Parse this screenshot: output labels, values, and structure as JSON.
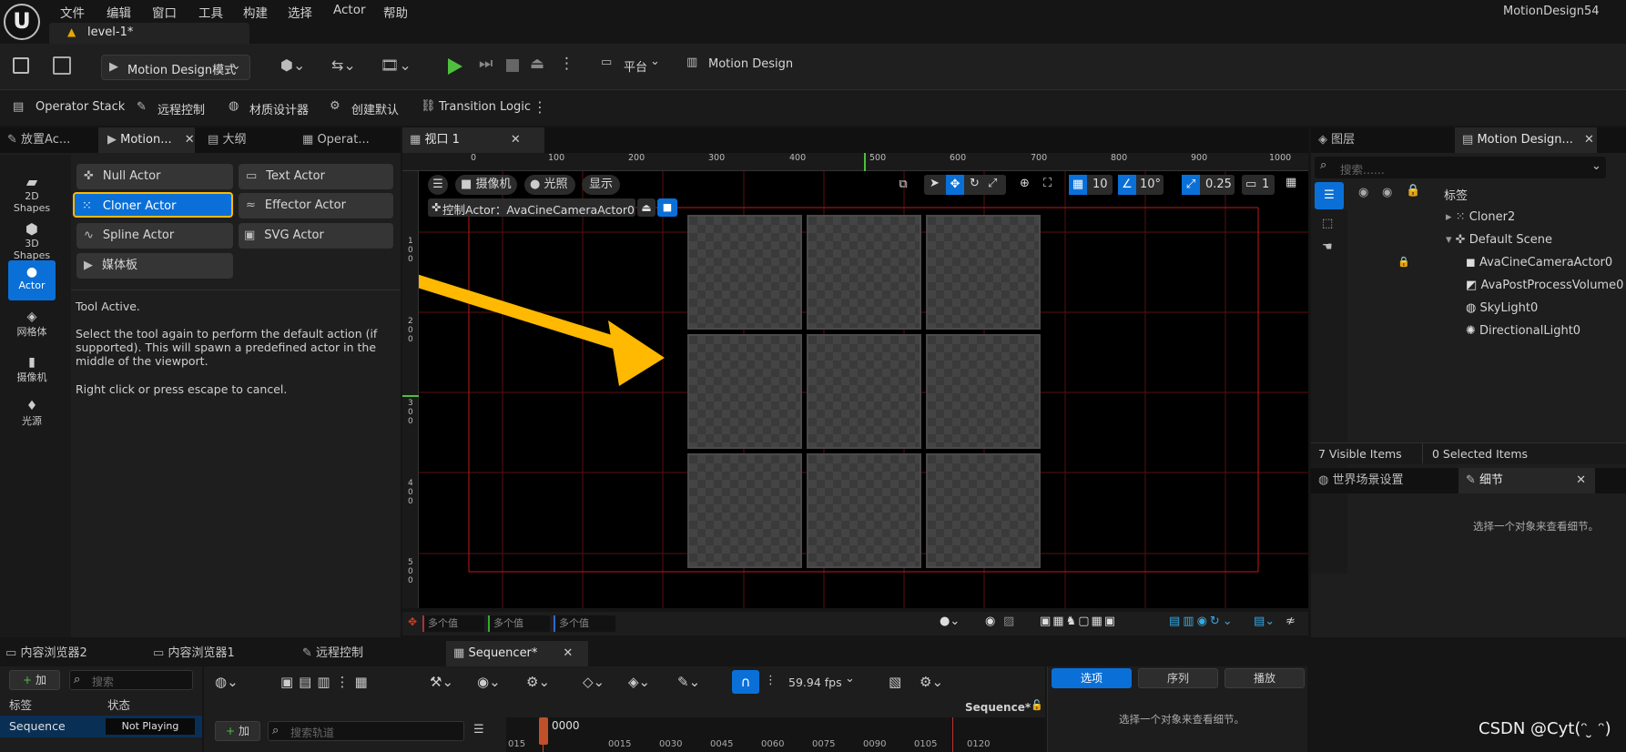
{
  "menu": {
    "items": [
      "文件",
      "编辑",
      "窗口",
      "工具",
      "构建",
      "选择",
      "Actor",
      "帮助"
    ],
    "project_name": "MotionDesign54",
    "level_tab": "level-1*"
  },
  "toolbar": {
    "mode_label": "Motion Design模式",
    "platform_label": "平台",
    "motion_design_label": "Motion Design"
  },
  "toolbar2": {
    "operator_stack": "Operator Stack",
    "remote_control": "远程控制",
    "material_designer": "材质设计器",
    "create_defaults": "创建默认",
    "transition_logic": "Transition Logic"
  },
  "left_panel": {
    "tabs": [
      "放置Ac...",
      "Motion...",
      "大纲",
      "Operat..."
    ],
    "rail": [
      "2D Shapes",
      "3D Shapes",
      "Actor",
      "网格体",
      "摄像机",
      "光源"
    ],
    "actors": [
      "Null Actor",
      "Text Actor",
      "Cloner Actor",
      "Effector Actor",
      "Spline Actor",
      "SVG Actor",
      "媒体板"
    ],
    "info_title": "Tool Active.",
    "info_body": "Select the tool again to perform the default action (if supported). This will spawn a predefined actor in the middle of the viewport.",
    "info_cancel": "Right click or press escape to cancel."
  },
  "viewport": {
    "tab_label": "视口 1",
    "ruler_top": [
      "0",
      "100",
      "200",
      "300",
      "400",
      "500",
      "600",
      "700",
      "800",
      "900",
      "1000"
    ],
    "ruler_left": [
      "1\n0\n0",
      "2\n0\n0",
      "3\n0\n0",
      "4\n0\n0",
      "5\n0\n0"
    ],
    "camera_btn": "摄像机",
    "lighting_btn": "光照",
    "show_btn": "显示",
    "pilot_label": "控制Actor：AvaCineCameraActor0",
    "grid_value": "10",
    "angle_value": "10°",
    "scale_value": "0.25",
    "cam_speed": "1",
    "bottom_fields": [
      "多个值",
      "多个值",
      "多个值"
    ]
  },
  "right_panel": {
    "tabs": [
      "图层",
      "Motion Design..."
    ],
    "search_placeholder": "搜索......",
    "column_label": "标签",
    "tree": [
      "Cloner2",
      "Default Scene",
      "AvaCineCameraActor0",
      "AvaPostProcessVolume0",
      "SkyLight0",
      "DirectionalLight0"
    ],
    "visible_items": "7  Visible Items",
    "selected_items": "0  Selected Items",
    "details_tabs": [
      "世界场景设置",
      "细节"
    ],
    "details_hint": "选择一个对象来查看细节。"
  },
  "bottom": {
    "tabs": [
      "内容浏览器2",
      "内容浏览器1",
      "远程控制",
      "Sequencer*"
    ],
    "add_label": "加",
    "search_placeholder": "搜索",
    "col_label": "标签",
    "col_status": "状态",
    "seq_name": "Sequence",
    "seq_status": "Not Playing",
    "fps": "59.94 fps",
    "seq_title": "Sequence*",
    "track_placeholder": "搜索轨道",
    "current_frame": "0000",
    "timeline_ticks": [
      "015",
      "0015",
      "0030",
      "0045",
      "0060",
      "0075",
      "0090",
      "0105",
      "0120"
    ],
    "right_tabs": [
      "选项",
      "序列",
      "播放"
    ],
    "right_hint": "选择一个对象来查看细节。",
    "watermark": "CSDN @Cyt(ᵔ ̮ ᵔ)"
  },
  "colors": {
    "accent": "#0a70d8",
    "highlight": "#ffb900",
    "play": "#4fbf3f"
  }
}
